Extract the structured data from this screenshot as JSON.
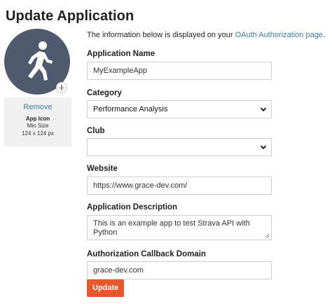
{
  "page": {
    "title": "Update Application"
  },
  "icon_panel": {
    "remove_label": "Remove",
    "icon_label": "App Icon",
    "min_size_label": "Min Size",
    "min_size_value": "124 x 124 px",
    "avatar_color": "#4f5a6e"
  },
  "intro": {
    "text": "The information below is displayed on your ",
    "link_text": "OAuth Authorization page",
    "suffix": "."
  },
  "form": {
    "app_name": {
      "label": "Application Name",
      "value": "MyExampleApp"
    },
    "category": {
      "label": "Category",
      "value": "Performance Analysis"
    },
    "club": {
      "label": "Club",
      "value": ""
    },
    "website": {
      "label": "Website",
      "value": "https://www.grace-dev.com/"
    },
    "description": {
      "label": "Application Description",
      "value": "This is an example app to test Strava API with Python"
    },
    "callback_domain": {
      "label": "Authorization Callback Domain",
      "value": "grace-dev.com"
    },
    "submit_label": "Update",
    "accent_color": "#e8562a"
  }
}
